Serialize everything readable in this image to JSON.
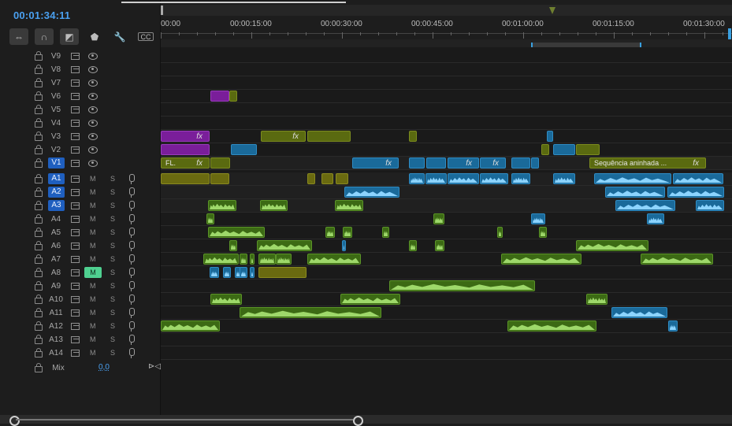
{
  "timecode": "00:01:34:11",
  "toolbar": {
    "icons": [
      "snap-icon",
      "magnet-icon",
      "linked-selection-icon",
      "marker-icon",
      "wrench-icon",
      "captions-icon"
    ],
    "captions_label": "CC"
  },
  "ruler": {
    "labels": [
      "00:00",
      "00:00:15:00",
      "00:00:30:00",
      "00:00:45:00",
      "00:01:00:00",
      "00:01:15:00",
      "00:01:30:00"
    ]
  },
  "video_tracks": [
    {
      "name": "V9"
    },
    {
      "name": "V8"
    },
    {
      "name": "V7"
    },
    {
      "name": "V6"
    },
    {
      "name": "V5"
    },
    {
      "name": "V4"
    },
    {
      "name": "V3"
    },
    {
      "name": "V2"
    },
    {
      "name": "V1",
      "selected": true
    }
  ],
  "audio_tracks": [
    {
      "name": "A1",
      "selected": true,
      "m": "M",
      "s": "S"
    },
    {
      "name": "A2",
      "selected": true,
      "m": "M",
      "s": "S"
    },
    {
      "name": "A3",
      "selected": true,
      "m": "M",
      "s": "S"
    },
    {
      "name": "A4",
      "m": "M",
      "s": "S"
    },
    {
      "name": "A5",
      "m": "M",
      "s": "S"
    },
    {
      "name": "A6",
      "m": "M",
      "s": "S"
    },
    {
      "name": "A7",
      "m": "M",
      "s": "S"
    },
    {
      "name": "A8",
      "m": "M",
      "s": "S",
      "mute_on": true
    },
    {
      "name": "A9",
      "m": "M",
      "s": "S"
    },
    {
      "name": "A10",
      "m": "M",
      "s": "S"
    },
    {
      "name": "A11",
      "m": "M",
      "s": "S"
    },
    {
      "name": "A12",
      "m": "M",
      "s": "S"
    },
    {
      "name": "A13",
      "m": "M",
      "s": "S"
    },
    {
      "name": "A14",
      "m": "M",
      "s": "S"
    }
  ],
  "mix": {
    "label": "Mix",
    "value": "0,0"
  },
  "clip_labels": {
    "v1_first": "FL.",
    "nested": "Sequência aninhada ...",
    "fx": "fx"
  },
  "colors": {
    "accent_blue": "#1f5fbf",
    "timecode": "#4aa0f0",
    "mute_on": "#4fd090",
    "video_olive": "#5a6a10",
    "video_purple": "#7a1e9a",
    "audio_blue": "#1a6a9a",
    "audio_green": "#3c6a14"
  }
}
